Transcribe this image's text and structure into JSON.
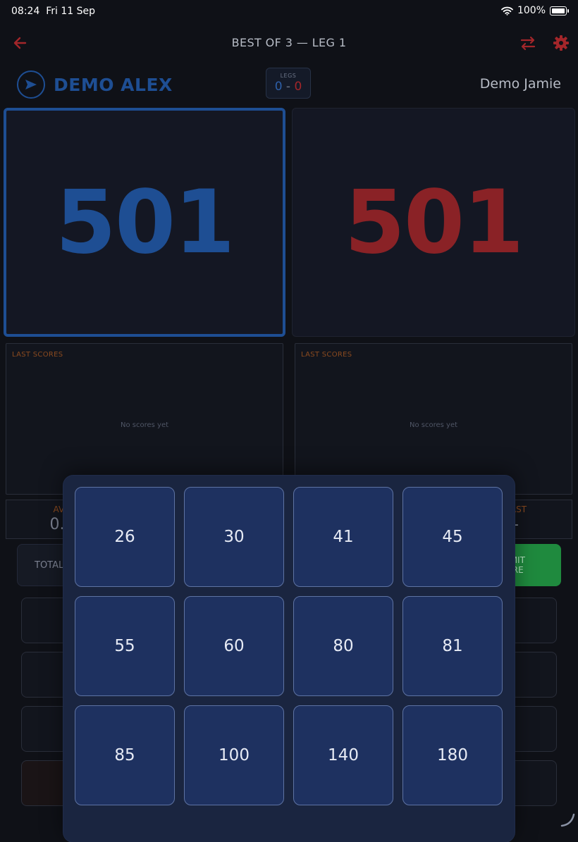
{
  "status": {
    "time": "08:24",
    "date": "Fri 11 Sep",
    "battery": "100%"
  },
  "header": {
    "title": "BEST OF 3 — LEG 1"
  },
  "players": {
    "p1": {
      "name": "DEMO ALEX",
      "score": "501"
    },
    "p2": {
      "name": "Demo Jamie",
      "score": "501"
    }
  },
  "legs": {
    "label": "LEGS",
    "p1": "0",
    "separator": "-",
    "p2": "0"
  },
  "last_scores": {
    "label": "LAST SCORES",
    "empty": "No scores yet"
  },
  "stats": {
    "avg_label": "AVG",
    "avg_value": "0.0",
    "last_label": "LAST",
    "last_value": "-"
  },
  "input": {
    "total_label": "TOTAL",
    "submit_line1": "SUBMIT",
    "submit_line2": "SCORE"
  },
  "presets": [
    "26",
    "30",
    "41",
    "45",
    "55",
    "60",
    "80",
    "81",
    "85",
    "100",
    "140",
    "180"
  ],
  "colors": {
    "p1": "#1e4e93",
    "p2": "#8a2226",
    "accent": "#a3262a",
    "submit": "#1f8a3e"
  }
}
